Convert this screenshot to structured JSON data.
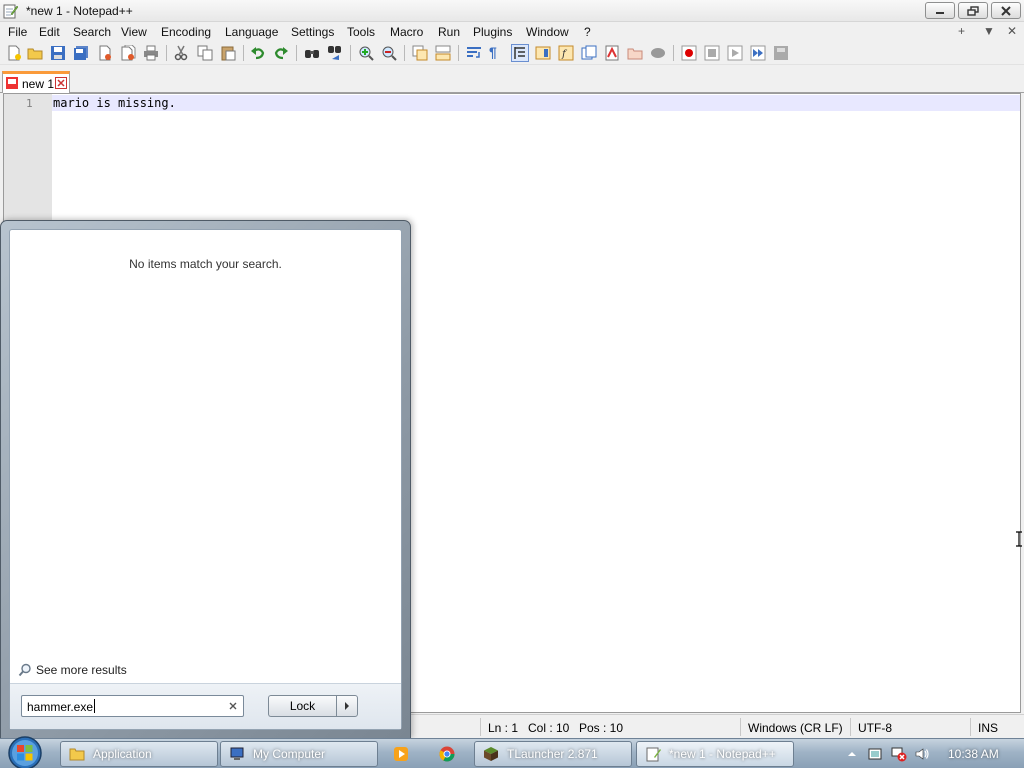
{
  "window": {
    "title": "*new 1 - Notepad++"
  },
  "menu": {
    "items": [
      "File",
      "Edit",
      "Search",
      "View",
      "Encoding",
      "Language",
      "Settings",
      "Tools",
      "Macro",
      "Run",
      "Plugins",
      "Window",
      "?"
    ],
    "right": [
      "+",
      "▼",
      "✕"
    ]
  },
  "toolbar": {
    "icons": [
      "new-file-icon",
      "open-file-icon",
      "save-icon",
      "save-all-icon",
      "close-icon",
      "close-all-icon",
      "print-icon",
      "cut-icon",
      "copy-icon",
      "paste-icon",
      "undo-icon",
      "redo-icon",
      "find-icon",
      "replace-icon",
      "zoom-in-icon",
      "zoom-out-icon",
      "sync-vertical-icon",
      "sync-horizontal-icon",
      "word-wrap-icon",
      "show-all-chars-icon",
      "indent-guide-icon",
      "document-map-icon",
      "function-list-icon",
      "folder-as-workspace-icon",
      "monitoring-icon",
      "record-macro-icon",
      "stop-macro-icon",
      "play-macro-icon",
      "run-macro-multiple-icon",
      "save-macro-icon"
    ]
  },
  "tabs": [
    {
      "label": "new 1",
      "active": true
    }
  ],
  "editor": {
    "line_number": "1",
    "text": "mario is missing."
  },
  "status": {
    "ln": "Ln : 1",
    "col": "Col : 10",
    "pos": "Pos : 10",
    "eol": "Windows (CR LF)",
    "encoding": "UTF-8",
    "mode": "INS"
  },
  "start_menu": {
    "no_results": "No items match your search.",
    "see_more": "See more results",
    "search_value": "hammer.exe",
    "lock_label": "Lock"
  },
  "taskbar": {
    "tasks": [
      {
        "label": "Application",
        "icon": "folder-icon"
      },
      {
        "label": "My Computer",
        "icon": "computer-icon"
      },
      {
        "label": "TLauncher 2.871",
        "icon": "minecraft-block-icon"
      },
      {
        "label": "*new 1 - Notepad++",
        "icon": "notepad-plus-plus-icon"
      }
    ],
    "clock": "10:38 AM"
  }
}
